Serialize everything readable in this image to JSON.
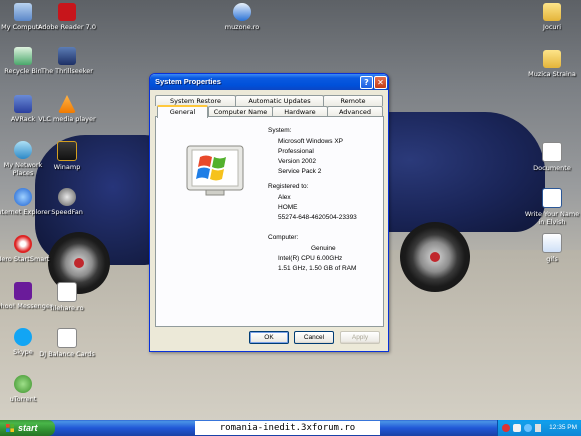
{
  "desktop": {
    "icons": [
      {
        "label": "My Computer",
        "icon": "my-computer-icon"
      },
      {
        "label": "Adobe Reader 7.0",
        "icon": "adobe-reader-icon"
      },
      {
        "label": "muzone.ro",
        "icon": "ie-shortcut-icon"
      },
      {
        "label": "Jocuri",
        "icon": "folder-icon"
      },
      {
        "label": "Recycle Bin",
        "icon": "recycle-bin-icon"
      },
      {
        "label": "The Thrillseeker",
        "icon": "app-icon"
      },
      {
        "label": "Muzica Straina",
        "icon": "folder-icon"
      },
      {
        "label": "AVRack",
        "icon": "avrack-icon"
      },
      {
        "label": "VLC media player",
        "icon": "vlc-icon"
      },
      {
        "label": "My Network Places",
        "icon": "network-places-icon"
      },
      {
        "label": "Winamp",
        "icon": "winamp-icon"
      },
      {
        "label": "Documente",
        "icon": "document-icon"
      },
      {
        "label": "Internet Explorer",
        "icon": "internet-explorer-icon"
      },
      {
        "label": "SpeedFan",
        "icon": "speedfan-icon"
      },
      {
        "label": "Write Your Name in Elvish",
        "icon": "word-document-icon"
      },
      {
        "label": "Nero StartSmart",
        "icon": "nero-icon"
      },
      {
        "label": "gifs",
        "icon": "image-file-icon"
      },
      {
        "label": "Yahoo! Messenger",
        "icon": "yahoo-messenger-icon"
      },
      {
        "label": "filehare.ro",
        "icon": "file-shortcut-icon"
      },
      {
        "label": "Skype",
        "icon": "skype-icon"
      },
      {
        "label": "DJ Balance Cards",
        "icon": "document-icon"
      },
      {
        "label": "uTorrent",
        "icon": "utorrent-icon"
      }
    ]
  },
  "window": {
    "title": "System Properties",
    "help_glyph": "?",
    "close_glyph": "✕",
    "tabs_row1": [
      "System Restore",
      "Automatic Updates",
      "Remote"
    ],
    "tabs_row2": [
      "General",
      "Computer Name",
      "Hardware",
      "Advanced"
    ],
    "active_tab": "General",
    "system": {
      "heading": "System:",
      "os": "Microsoft Windows XP",
      "edition": "Professional",
      "version": "Version 2002",
      "service_pack": "Service Pack 2"
    },
    "registered": {
      "heading": "Registered to:",
      "name": "Alex",
      "org": "HOME",
      "product_id": "55274-648-4620504-23393"
    },
    "computer": {
      "heading": "Computer:",
      "vendor": "Genuine",
      "cpu": "Intel(R) CPU 6.00GHz",
      "ram": "1.51 GHz, 1.50 GB of RAM"
    },
    "buttons": {
      "ok": "OK",
      "cancel": "Cancel",
      "apply": "Apply"
    }
  },
  "taskbar": {
    "start_label": "start",
    "clock": "12:35 PM"
  },
  "watermark": "romania-inedit.3xforum.ro",
  "colors": {
    "title_blue": "#0050da",
    "start_green": "#3c9a3c",
    "tray_blue": "#0f86d6"
  }
}
